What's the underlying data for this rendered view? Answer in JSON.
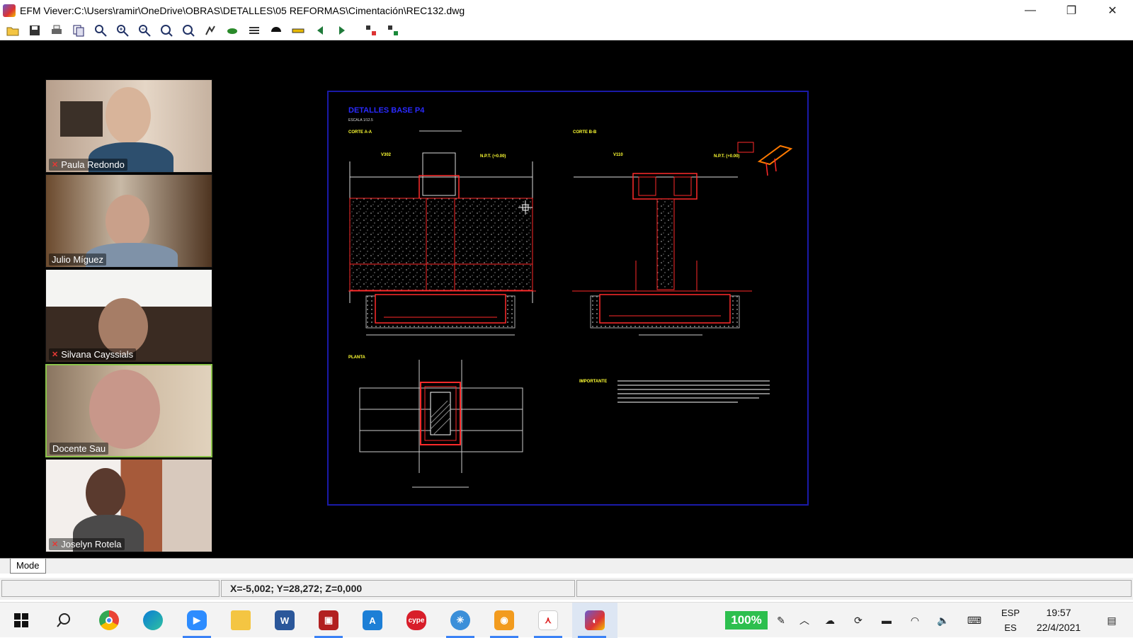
{
  "window": {
    "title": "EFM Viever:C:\\Users\\ramir\\OneDrive\\OBRAS\\DETALLES\\05 REFORMAS\\Cimentación\\REC132.dwg",
    "controls": {
      "minimize": "—",
      "restore": "❐",
      "close": "✕"
    }
  },
  "toolbar": {
    "buttons": [
      "open-folder-icon",
      "save-icon",
      "print-icon",
      "copy-icon",
      "zoom-window-icon",
      "zoom-in-icon",
      "zoom-out-icon",
      "zoom-extents-icon",
      "zoom-previous-icon",
      "pan-icon",
      "layers-icon",
      "layer-list-icon",
      "background-icon",
      "measure-icon",
      "back-arrow-icon",
      "forward-arrow-icon",
      "compare-icon",
      "export-icon"
    ]
  },
  "participants": [
    {
      "name": "Paula Redondo",
      "muted": true
    },
    {
      "name": "Julio Míguez",
      "muted": false
    },
    {
      "name": "Silvana Cayssials",
      "muted": true
    },
    {
      "name": "Docente Sau",
      "muted": false,
      "speaking": true
    },
    {
      "name": "Joselyn Rotela",
      "muted": true
    }
  ],
  "drawing": {
    "title": "DETALLES BASE P4",
    "scale": "ESCALA 1/12.5",
    "section_a": "CORTE A-A",
    "section_b": "CORTE B-B",
    "plan": "PLANTA",
    "beam_a": "V302",
    "beam_b": "V110",
    "npt_a": "N.P.T. (+0.00)",
    "npt_b": "N.P.T. (+0.00)",
    "important": "IMPORTANTE"
  },
  "mode_tab": {
    "label": "Mode"
  },
  "status": {
    "coordinates": "X=-5,002; Y=28,272; Z=0,000"
  },
  "taskbar": {
    "apps": [
      "windows-start-icon",
      "search-icon",
      "chrome-icon",
      "edge-icon",
      "zoom-icon",
      "file-explorer-icon",
      "word-icon",
      "photo-viewer-icon",
      "autodesk-icon",
      "cype-icon",
      "settings-globe-icon",
      "outlook-icon",
      "acrobat-icon",
      "efm-viewer-icon"
    ],
    "zoom_level": "100%",
    "lang_top": "ESP",
    "lang_bottom": "ES",
    "time": "19:57",
    "date": "22/4/2021"
  }
}
